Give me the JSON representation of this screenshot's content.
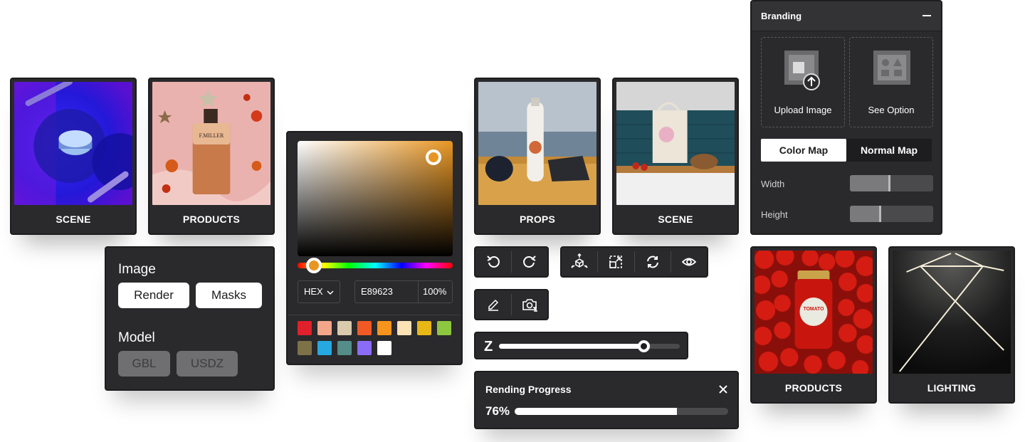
{
  "cards": {
    "scene_1": {
      "label": "SCENE"
    },
    "products_1": {
      "label": "PRODUCTS",
      "bottle_text": "F.MILLER"
    },
    "props": {
      "label": "PROPS"
    },
    "scene_2": {
      "label": "SCENE"
    },
    "products_2": {
      "label": "PRODUCTS",
      "jar_text": "TOMATO"
    },
    "lighting": {
      "label": "LIGHTING"
    }
  },
  "image_panel": {
    "image_title": "Image",
    "render_label": "Render",
    "masks_label": "Masks",
    "model_title": "Model",
    "glb_label": "GBL",
    "usdz_label": "USDZ"
  },
  "color_picker": {
    "selected_color": "#e89623",
    "format_label": "HEX",
    "hex_value": "E89623",
    "opacity": "100%",
    "swatches": [
      "#e0202a",
      "#f4a68a",
      "#d9c9ad",
      "#f15a24",
      "#f7941d",
      "#fde2b5",
      "#e9b716",
      "#8dc63f",
      "#7d7147",
      "#26a9e0",
      "#548d89",
      "#8b6cf6",
      "#ffffff"
    ]
  },
  "toolbar_history": {
    "icons": [
      "undo-icon",
      "redo-icon"
    ]
  },
  "toolbar_transform": {
    "icons": [
      "move-3d-icon",
      "resize-icon",
      "refresh-icon",
      "eye-icon"
    ]
  },
  "toolbar_edit": {
    "icons": [
      "pencil-icon",
      "camera-rotate-icon"
    ]
  },
  "z_slider": {
    "label": "Z",
    "value": 0.8
  },
  "rendering": {
    "title": "Rending Progress",
    "percent_label": "76%",
    "progress": 0.76
  },
  "branding": {
    "title": "Branding",
    "upload_label": "Upload Image",
    "option_label": "See Option",
    "color_map_label": "Color Map",
    "normal_map_label": "Normal Map",
    "width_label": "Width",
    "width_value": 0.49,
    "height_label": "Height",
    "height_value": 0.38
  }
}
